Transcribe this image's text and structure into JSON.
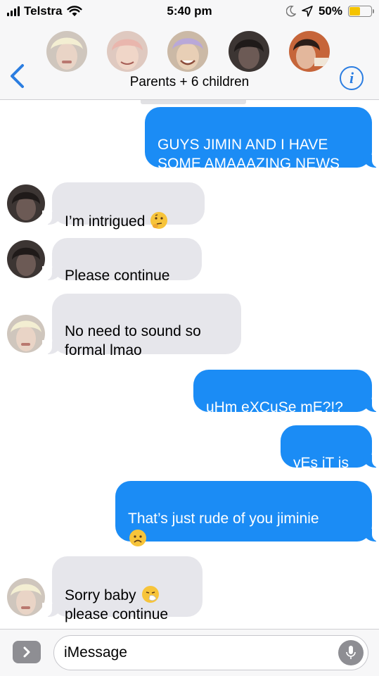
{
  "status_bar": {
    "carrier": "Telstra",
    "time": "5:40 pm",
    "battery_percent": "50%",
    "battery_level": 0.5,
    "icons": [
      "signal-bars-icon",
      "wifi-icon",
      "do-not-disturb-moon-icon",
      "location-arrow-icon",
      "battery-icon"
    ]
  },
  "conversation": {
    "title": "Parents + 6 children",
    "back_icon": "chevron-left-icon",
    "info_label": "i",
    "participant_count_shown": 5
  },
  "messages": [
    {
      "direction": "outgoing",
      "text": "GUYS JIMIN AND I HAVE\nSOME AMAAAZING NEWS"
    },
    {
      "direction": "incoming",
      "text": "I’m intrigued",
      "emoji": "thinking-face-emoji"
    },
    {
      "direction": "incoming",
      "text": "Please continue"
    },
    {
      "direction": "incoming",
      "text": "No need to sound so\nformal lmao"
    },
    {
      "direction": "outgoing",
      "text": "uHm eXCuSe mE?!?"
    },
    {
      "direction": "outgoing",
      "text": "yEs iT is"
    },
    {
      "direction": "outgoing",
      "text": "That’s just rude of you jiminie",
      "emoji": "frowning-face-emoji"
    },
    {
      "direction": "incoming",
      "text": "Sorry baby",
      "emoji": "sneezing-face-emoji",
      "text2": "please continue"
    }
  ],
  "input": {
    "placeholder": "iMessage",
    "app_button_icon": "chevron-right-icon",
    "mic_icon": "microphone-icon"
  },
  "colors": {
    "outgoing_bubble": "#1b8cf5",
    "incoming_bubble": "#e6e6eb",
    "accent": "#2b7de1",
    "battery": "#f5c400"
  }
}
